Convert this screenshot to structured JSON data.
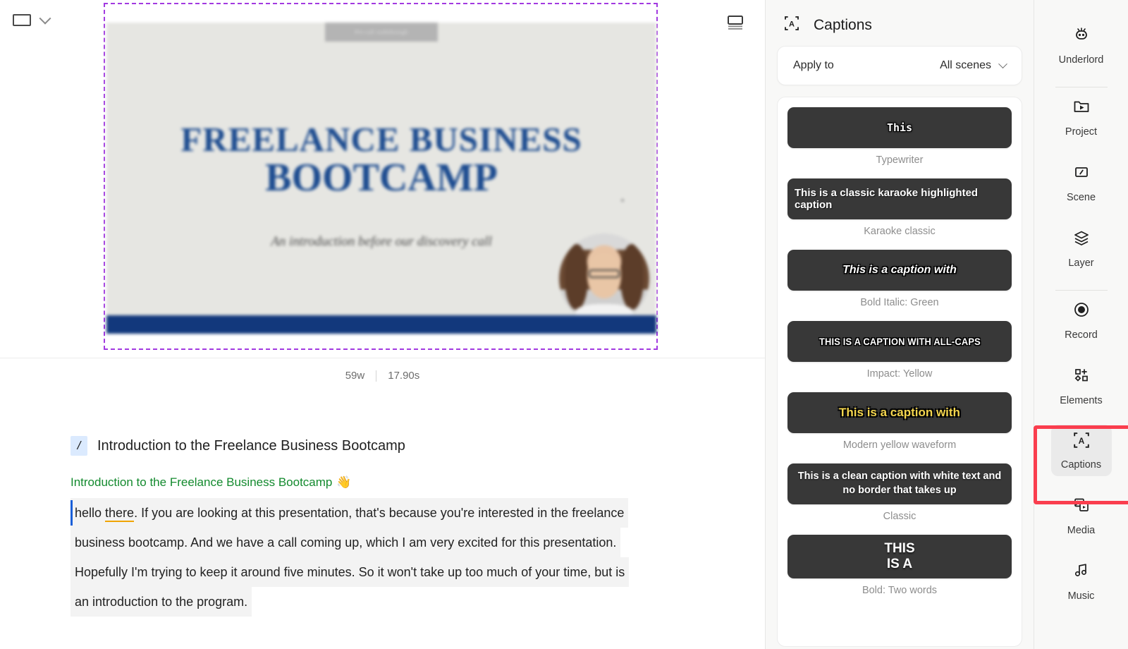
{
  "toolbar": {
    "aspect_ratio_icon": "rectangle-icon",
    "aspect_ratio_chevron": "chevron-down-icon",
    "layout_icon": "slide-layout-icon"
  },
  "preview": {
    "slide_badge_text": "Pre-call walkthrough",
    "slide_title_line1": "FREELANCE BUSINESS",
    "slide_title_line2": "BOOTCAMP",
    "slide_subtitle": "An introduction before our discovery call",
    "accent_color": "#12387c",
    "selection_border_color": "#a23ae0"
  },
  "meta": {
    "word_count": "59w",
    "duration": "17.90s"
  },
  "transcript": {
    "scene_badge": "/",
    "scene_title": "Introduction to the Freelance Business Bootcamp",
    "green_heading": "Introduction to the Freelance Business Bootcamp",
    "green_emoji": "👋",
    "green_color": "#138a2e",
    "lines": [
      {
        "pre": "hello ",
        "mis": "there",
        "post": ". If you are looking at this presentation, that's because you're interested in the freelance"
      },
      {
        "pre": "",
        "mis": "",
        "post": "business bootcamp. And we have a call coming up, which I am very excited for this presentation."
      },
      {
        "pre": "",
        "mis": "",
        "post": "Hopefully I'm trying to keep it around five minutes. So it won't take up too much of your time, but is"
      },
      {
        "pre": "",
        "mis": "",
        "post": "an introduction to the program."
      }
    ]
  },
  "captions_panel": {
    "icon": "captions-icon",
    "title": "Captions",
    "apply_to_label": "Apply to",
    "apply_to_value": "All scenes",
    "apply_to_chevron": "chevron-down-icon",
    "styles": [
      {
        "preview_text": "This",
        "name": "Typewriter",
        "class": "s-typewriter"
      },
      {
        "preview_text": "This is a classic karaoke highlighted caption",
        "name": "Karaoke classic",
        "class": "s-karaoke"
      },
      {
        "preview_text": "This is a caption with",
        "name": "Bold Italic: Green",
        "class": "s-bolditalic"
      },
      {
        "preview_text": "THIS IS A CAPTION WITH ALL-CAPS",
        "name": "Impact: Yellow",
        "class": "s-impact"
      },
      {
        "preview_text": "This is a caption with",
        "name": "Modern yellow waveform",
        "class": "s-yellow"
      },
      {
        "preview_text": "This is a clean caption with white text and no border that takes up",
        "name": "Classic",
        "class": "s-classic"
      },
      {
        "preview_text": "THIS\nIS A",
        "name": "Bold: Two words",
        "class": "s-twowords"
      }
    ]
  },
  "rail": {
    "highlight_color": "#fa3e4e",
    "items": [
      {
        "label": "Underlord",
        "icon": "robot-icon",
        "active": false
      },
      {
        "label": "Project",
        "icon": "folder-play-icon",
        "active": false
      },
      {
        "label": "Scene",
        "icon": "scene-slash-icon",
        "active": false
      },
      {
        "label": "Layer",
        "icon": "layers-icon",
        "active": false
      },
      {
        "label": "Record",
        "icon": "record-circle-icon",
        "active": false
      },
      {
        "label": "Elements",
        "icon": "shapes-plus-icon",
        "active": false
      },
      {
        "label": "Captions",
        "icon": "captions-icon",
        "active": true
      },
      {
        "label": "Media",
        "icon": "media-stack-icon",
        "active": false
      },
      {
        "label": "Music",
        "icon": "music-note-icon",
        "active": false
      }
    ]
  }
}
